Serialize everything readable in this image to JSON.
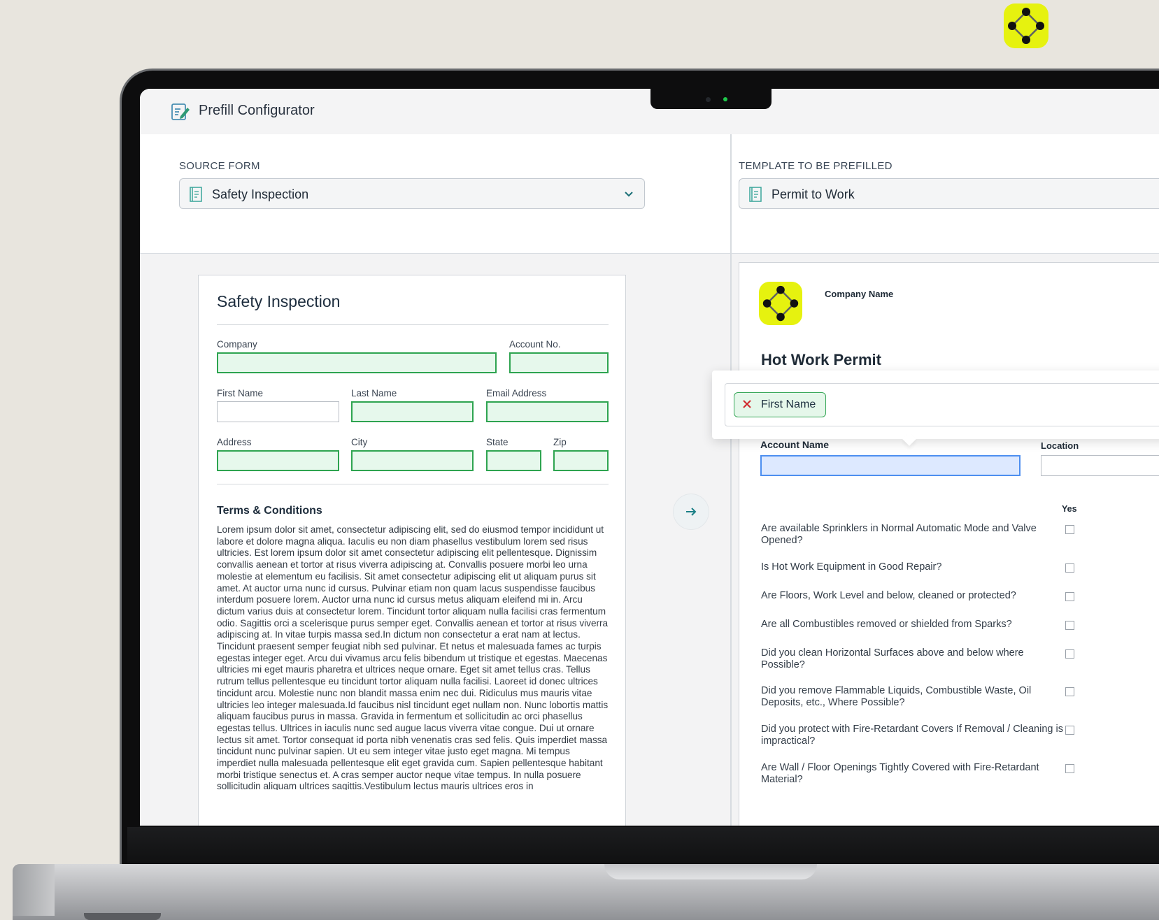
{
  "app": {
    "title": "Prefill Configurator"
  },
  "colors": {
    "brand_yellow": "#e6f20f",
    "field_green": "#2ea450",
    "field_blue": "#4d8ff0",
    "remove_red": "#d0262a"
  },
  "source": {
    "label": "SOURCE FORM",
    "selected": "Safety Inspection",
    "icon": "document-icon",
    "doc": {
      "title": "Safety Inspection",
      "fields": {
        "company": "Company",
        "account_no": "Account No.",
        "first_name": "First Name",
        "last_name": "Last Name",
        "email": "Email Address",
        "address": "Address",
        "city": "City",
        "state": "State",
        "zip": "Zip"
      },
      "terms_title": "Terms & Conditions",
      "terms_body": "Lorem ipsum dolor sit amet, consectetur adipiscing elit, sed do eiusmod tempor incididunt ut labore et dolore magna aliqua. Iaculis eu non diam phasellus vestibulum lorem sed risus ultricies. Est lorem ipsum dolor sit amet consectetur adipiscing elit pellentesque. Dignissim convallis aenean et tortor at risus viverra adipiscing at. Convallis posuere morbi leo urna molestie at elementum eu facilisis. Sit amet consectetur adipiscing elit ut aliquam purus sit amet. At auctor urna nunc id cursus. Pulvinar etiam non quam lacus suspendisse faucibus interdum posuere lorem. Auctor urna nunc id cursus metus aliquam eleifend mi in. Arcu dictum varius duis at consectetur lorem. Tincidunt tortor aliquam nulla facilisi cras fermentum odio. Sagittis orci a scelerisque purus semper eget. Convallis aenean et tortor at risus viverra adipiscing at. In vitae turpis massa sed.In dictum non consectetur a erat nam at lectus. Tincidunt praesent semper feugiat nibh sed pulvinar. Et netus et malesuada fames ac turpis egestas integer eget. Arcu dui vivamus arcu felis bibendum ut tristique et egestas. Maecenas ultricies mi eget mauris pharetra et ultrices neque ornare. Eget sit amet tellus cras. Tellus rutrum tellus pellentesque eu tincidunt tortor aliquam nulla facilisi. Laoreet id donec ultrices tincidunt arcu. Molestie nunc non blandit massa enim nec dui. Ridiculus mus mauris vitae ultricies leo integer malesuada.Id faucibus nisl tincidunt eget nullam non. Nunc lobortis mattis aliquam faucibus purus in massa. Gravida in fermentum et sollicitudin ac orci phasellus egestas tellus. Ultrices in iaculis nunc sed augue lacus viverra vitae congue. Dui ut ornare lectus sit amet. Tortor consequat id porta nibh venenatis cras sed felis. Quis imperdiet massa tincidunt nunc pulvinar sapien. Ut eu sem integer vitae justo eget magna. Mi tempus imperdiet nulla malesuada pellentesque elit eget gravida cum. Sapien pellentesque habitant morbi tristique senectus et. A cras semper auctor neque vitae tempus. In nulla posuere sollicitudin aliquam ultrices sagittis.Vestibulum lectus mauris ultrices eros in"
    }
  },
  "target": {
    "label": "TEMPLATE TO BE PREFILLED",
    "selected": "Permit to Work",
    "icon": "document-icon",
    "doc": {
      "company_name": "Company Name",
      "title": "Hot Work Permit",
      "account_name_label": "Account Name",
      "location_label": "Location",
      "yes_label": "Yes",
      "questions": [
        "Are available Sprinklers in Normal Automatic Mode and Valve Opened?",
        "Is Hot Work Equipment in Good Repair?",
        "Are Floors, Work Level and below, cleaned or protected?",
        "Are all Combustibles removed or shielded from Sparks?",
        "Did you clean Horizontal Surfaces above and below where Possible?",
        "Did you remove Flammable Liquids, Combustible Waste, Oil Deposits, etc., Where Possible?",
        "Did you protect with Fire-Retardant Covers If Removal / Cleaning is impractical?",
        "Are Wall / Floor Openings Tightly Covered with Fire-Retardant Material?"
      ]
    }
  },
  "mapping": {
    "chip_label": "First Name",
    "remove_icon": "close-icon",
    "arrow_icon": "arrow-right-icon"
  }
}
